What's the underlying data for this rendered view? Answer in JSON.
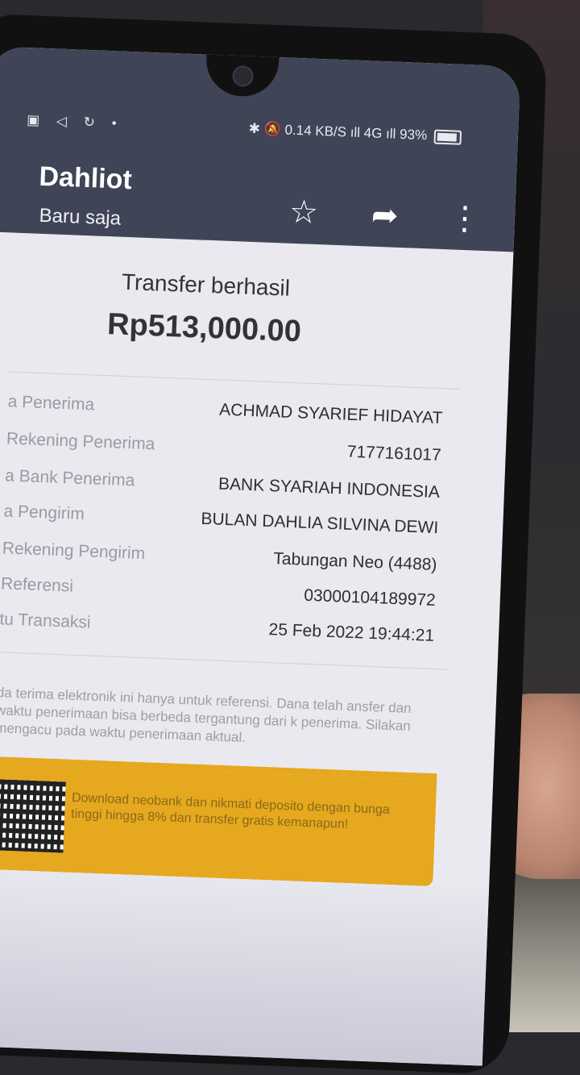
{
  "status_bar": {
    "left_icons": "▣ ◁ ↻ •",
    "right_text": "✱ 🔕 0.14 KB/S ıll 4G ıll 93%"
  },
  "appbar": {
    "title": "Dahliot",
    "subtitle": "Baru saja",
    "star_icon": "☆",
    "share_icon": "➦",
    "more_icon": "⋮"
  },
  "receipt": {
    "status": "Transfer berhasil",
    "amount": "Rp513,000.00",
    "rows": [
      {
        "label": "a Penerima",
        "value": "ACHMAD SYARIEF HIDAYAT"
      },
      {
        "label": "Rekening Penerima",
        "value": "7177161017"
      },
      {
        "label": "a Bank Penerima",
        "value": "BANK SYARIAH INDONESIA"
      },
      {
        "label": "a Pengirim",
        "value": "BULAN DAHLIA SILVINA DEWI"
      },
      {
        "label": "Rekening Pengirim",
        "value": "Tabungan Neo (4488)"
      },
      {
        "label": "Referensi",
        "value": "03000104189972"
      },
      {
        "label": "tu Transaksi",
        "value": "25 Feb 2022 19:44:21"
      }
    ],
    "note": "da terima elektronik ini hanya untuk referensi. Dana telah ansfer dan waktu penerimaan bisa berbeda tergantung dari k penerima. Silakan mengacu pada waktu penerimaan aktual."
  },
  "promo": {
    "text": "Download neobank dan nikmati deposito dengan bunga tinggi hingga 8% dan transfer gratis kemanapun!"
  }
}
